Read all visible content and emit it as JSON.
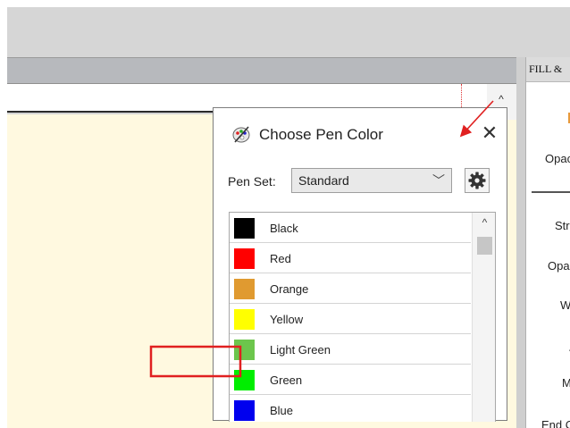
{
  "right_panel": {
    "header": "FILL &",
    "labels": [
      "Opac",
      "Stro",
      "Opac",
      "Wic",
      "Jo",
      "Mit",
      "End C"
    ]
  },
  "dialog": {
    "title": "Choose Pen Color",
    "close_glyph": "✕",
    "pen_set_label": "Pen Set:",
    "pen_set_value": "Standard",
    "pens": [
      {
        "name": "Black",
        "color": "#000000"
      },
      {
        "name": "Red",
        "color": "#ff0000"
      },
      {
        "name": "Orange",
        "color": "#e09a30"
      },
      {
        "name": "Yellow",
        "color": "#ffff00"
      },
      {
        "name": "Light Green",
        "color": "#6cc64c"
      },
      {
        "name": "Green",
        "color": "#00ee00"
      },
      {
        "name": "Blue",
        "color": "#0000ee"
      }
    ]
  },
  "icons": {
    "dialog_icon": "pen-color-palette-icon",
    "gear": "gear-icon",
    "chevron": "chevron-down-icon",
    "close": "close-icon"
  },
  "annotations": {
    "arrow_color": "#e02020",
    "box_color": "#e02020"
  }
}
